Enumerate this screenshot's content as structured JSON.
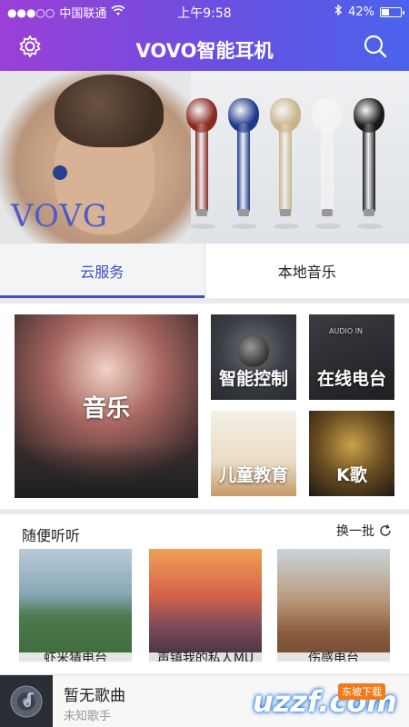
{
  "status": {
    "carrier": "中国联通",
    "time": "上午9:58",
    "battery": "42%",
    "battery_level": 0.42
  },
  "header": {
    "title": "VOVO智能耳机"
  },
  "banner": {
    "logo_text": "VOVG",
    "earbud_colors": [
      "#8a2a22",
      "#1f3a8c",
      "#c8b48a",
      "#f2f2f2",
      "#1a1a1a"
    ],
    "page_count": 2,
    "active_page": 1
  },
  "tabs": [
    {
      "label": "云服务",
      "active": true
    },
    {
      "label": "本地音乐",
      "active": false
    }
  ],
  "categories": {
    "music": "音乐",
    "smart_control": "智能控制",
    "online_radio": "在线电台",
    "kids_education": "儿童教育",
    "ktv": "K歌",
    "radio_device_text": "AUDIO IN"
  },
  "random": {
    "title": "随便听听",
    "refresh_label": "换一批",
    "items": [
      {
        "title": "虾米猜电台"
      },
      {
        "title": "声镇我的私人MU"
      },
      {
        "title": "伤感电台"
      }
    ]
  },
  "player": {
    "song": "暂无歌曲",
    "artist": "未知歌手"
  },
  "watermark": {
    "text": "uzzf.com",
    "badge": "东坡下载"
  },
  "colors": {
    "accent": "#3f4fc1",
    "header_gradient_start": "#9b3fd6",
    "header_gradient_end": "#4a63ec"
  }
}
